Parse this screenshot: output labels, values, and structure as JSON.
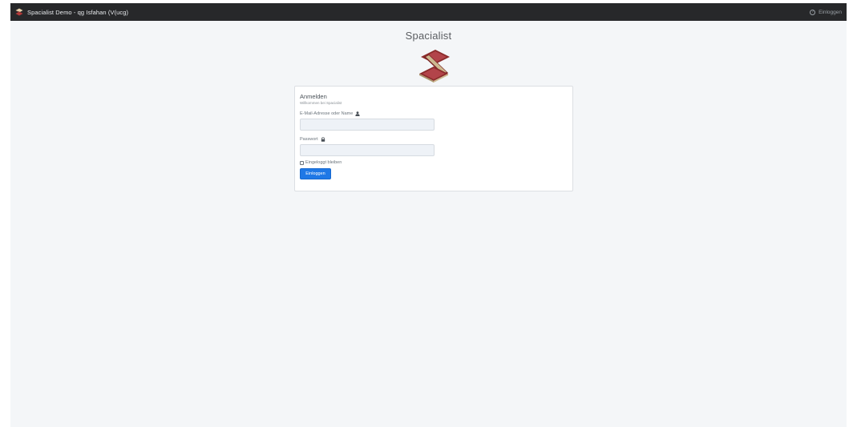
{
  "navbar": {
    "brand_icon": "spacialist-logo-icon",
    "brand_text": "Spacialist Demo - qg Isfahan (V(ucg)",
    "login_icon": "question-circle-icon",
    "login_label": "Einloggen"
  },
  "app": {
    "title": "Spacialist",
    "logo_icon": "spacialist-s-logo",
    "logo_colors": {
      "dark": "#8b2b2b",
      "light": "#cdb88f"
    }
  },
  "login_card": {
    "title": "Anmelden",
    "subtitle": "Willkommen bei Spacialist",
    "email_label": "E-Mail-Adresse oder Name",
    "email_icon": "user-icon",
    "email_value": "",
    "password_label": "Passwort",
    "password_icon": "lock-icon",
    "password_value": "",
    "remember_label": "Eingeloggt bleiben",
    "remember_checked": false,
    "submit_label": "Einloggen"
  },
  "colors": {
    "navbar_bg": "#27282a",
    "page_bg": "#f4f6f8",
    "primary": "#1f78e6"
  }
}
